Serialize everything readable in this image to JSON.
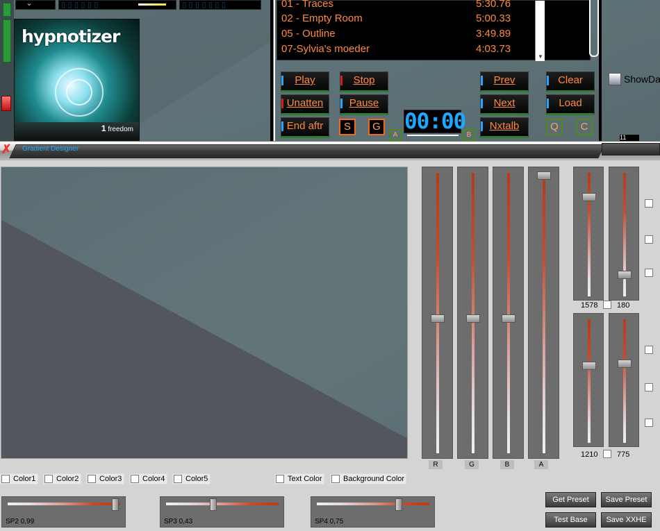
{
  "playlist": {
    "tracks": [
      {
        "name": "01 - Traces",
        "time": "5:30.76"
      },
      {
        "name": "02 - Empty Room",
        "time": "5:00.33"
      },
      {
        "name": "05 - Outline",
        "time": "3:49.89"
      },
      {
        "name": "07-Sylvia's moeder",
        "time": "4:03.73"
      }
    ]
  },
  "album": {
    "title": "hypnotizer",
    "sub_num": "1",
    "sub_text": "freedom"
  },
  "controls": {
    "play": "Play",
    "stop": "Stop",
    "unatten": "Unatten",
    "pause": "Pause",
    "end_aftr": "End aftr",
    "s": "S",
    "g": "G",
    "prev": "Prev",
    "clear": "Clear",
    "next": "Next",
    "load": "Load",
    "nxtalb": "Nxtalb",
    "q": "Q",
    "c": "C",
    "a_marker": "A",
    "b_marker": "B",
    "timer": "00:00",
    "show_label": "ShowDa",
    "mini_num": "11"
  },
  "window": {
    "title": "Gradient Designer"
  },
  "rgba_sliders": [
    {
      "label": "R",
      "value_fraction": 0.52
    },
    {
      "label": "G",
      "value_fraction": 0.52
    },
    {
      "label": "B",
      "value_fraction": 0.52
    },
    {
      "label": "A",
      "value_fraction": 0.0
    }
  ],
  "sp1_sliders": {
    "left_value": "1578",
    "right_value": "180"
  },
  "sp2_sliders": {
    "left_value": "1210",
    "right_value": "775"
  },
  "color_checkboxes": [
    "Color1",
    "Color2",
    "Color3",
    "Color4",
    "Color5"
  ],
  "text_color_label": "Text Color",
  "background_color_label": "Background Color",
  "sp_sliders": [
    {
      "label": "SP2 0,99",
      "value": 0.99
    },
    {
      "label": "SP3 0,43",
      "value": 0.43
    },
    {
      "label": "SP4 0,75",
      "value": 0.75
    }
  ],
  "buttons": {
    "get_preset": "Get Preset",
    "save_preset": "Save Preset",
    "test_base": "Test Base",
    "save_xxhe": "Save XXHE"
  }
}
